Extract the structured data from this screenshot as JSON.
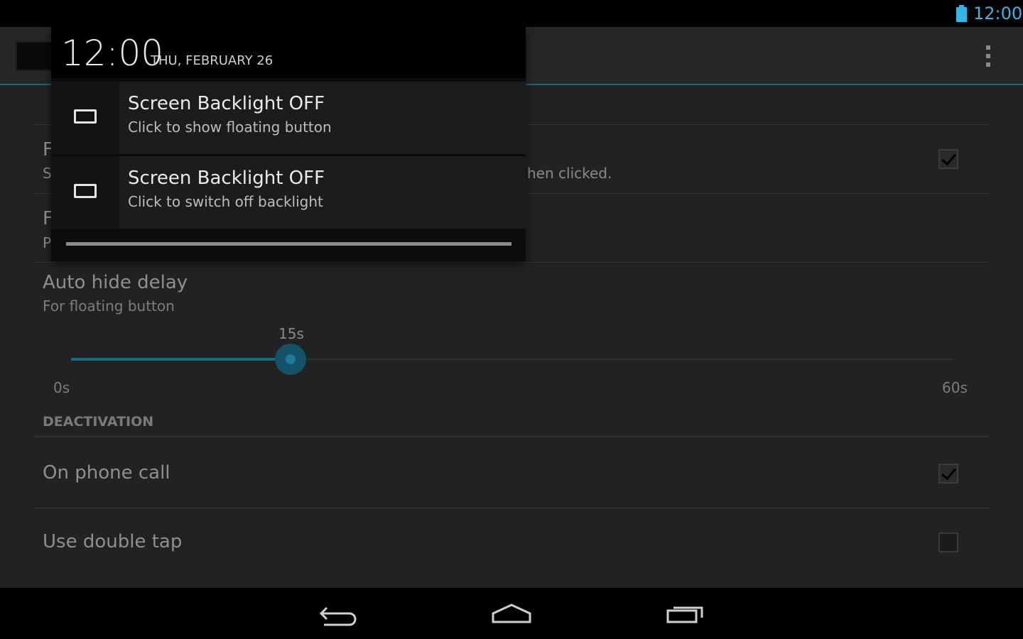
{
  "status_bar": {
    "time": "12:00",
    "icons": [
      "battery-icon"
    ],
    "accent": "#33b5e5"
  },
  "action_bar": {
    "overflow_icon": "overflow-menu-icon"
  },
  "preferences": {
    "partial_row1_title": "F",
    "partial_row1_summary": "S",
    "partial_row1_summary_tail": "hen clicked.",
    "partial_row2_title": "F",
    "partial_row2_summary": "P",
    "auto_hide": {
      "title": "Auto hide delay",
      "summary": "For floating button",
      "value_label": "15s",
      "min_label": "0s",
      "max_label": "60s",
      "value_fraction": 0.25
    },
    "section_header": "DEACTIVATION",
    "on_phone_call": {
      "title": "On phone call",
      "checked": true
    },
    "double_tap": {
      "title": "Use double tap",
      "checked": false
    }
  },
  "shade": {
    "clock": "12:00",
    "date": "THU, FEBRUARY 26",
    "notifications": [
      {
        "title": "Screen Backlight OFF",
        "text": "Click to show floating button",
        "icon": "screen-icon"
      },
      {
        "title": "Screen Backlight OFF",
        "text": "Click to switch off backlight",
        "icon": "screen-icon"
      }
    ]
  },
  "nav": {
    "back_icon": "back-icon",
    "home_icon": "home-icon",
    "recents_icon": "recents-icon"
  }
}
